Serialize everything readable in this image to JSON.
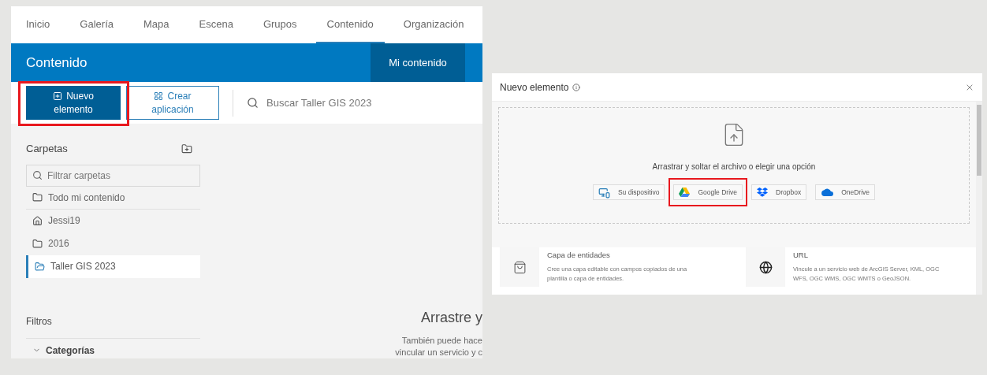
{
  "nav_tabs": [
    {
      "label": "Inicio",
      "selected": false
    },
    {
      "label": "Galería",
      "selected": false
    },
    {
      "label": "Mapa",
      "selected": false
    },
    {
      "label": "Escena",
      "selected": false
    },
    {
      "label": "Grupos",
      "selected": false
    },
    {
      "label": "Contenido",
      "selected": true
    },
    {
      "label": "Organización",
      "selected": false
    }
  ],
  "banner": {
    "title": "Contenido",
    "tab": "Mi contenido"
  },
  "toolbar": {
    "new_item": {
      "label_lines": [
        "Nuevo",
        "elemento"
      ],
      "highlighted": true
    },
    "create_app": {
      "label_lines": [
        "Crear",
        "aplicación"
      ]
    },
    "search": {
      "placeholder": "Buscar Taller GIS 2023"
    }
  },
  "folders": {
    "title": "Carpetas",
    "filter_placeholder": "Filtrar carpetas",
    "items": [
      {
        "label": "Todo mi contenido",
        "kind": "folder",
        "selected": false
      },
      {
        "label": "Jessi19",
        "kind": "home",
        "selected": false
      },
      {
        "label": "2016",
        "kind": "folder",
        "selected": false
      },
      {
        "label": "Taller GIS 2023",
        "kind": "folder",
        "selected": true
      }
    ]
  },
  "filters": {
    "title": "Filtros",
    "sections": [
      {
        "label": "Categorías",
        "expanded": false
      }
    ]
  },
  "empty_state": {
    "heading": "Arrastre y",
    "lines": [
      "También puede hace",
      "vincular un servicio y c"
    ]
  },
  "dialog": {
    "title": "Nuevo elemento",
    "dropzone": {
      "prompt": "Arrastrar y soltar el archivo o elegir una opción",
      "sources": [
        {
          "label": "Su dispositivo",
          "kind": "device",
          "highlighted": false
        },
        {
          "label": "Google Drive",
          "kind": "gdrive",
          "highlighted": true
        },
        {
          "label": "Dropbox",
          "kind": "dropbox",
          "highlighted": false
        },
        {
          "label": "OneDrive",
          "kind": "onedrive",
          "highlighted": false
        }
      ]
    },
    "options": [
      {
        "kind": "feature-layer",
        "title": "Capa de entidades",
        "description": "Cree una capa editable con campos copiados de una plantilla o capa de entidades."
      },
      {
        "kind": "url",
        "title": "URL",
        "description": "Vincule a un servicio web de ArcGIS Server, KML, OGC WFS, OGC WMS, OGC WMTS o GeoJSON."
      }
    ]
  }
}
